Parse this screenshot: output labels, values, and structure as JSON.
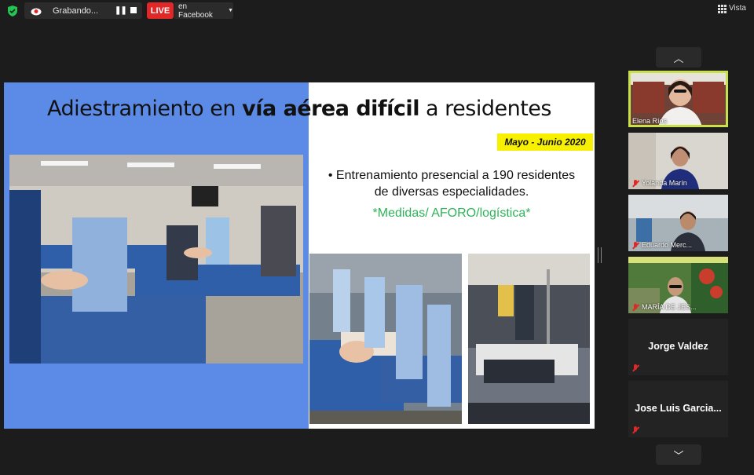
{
  "topbar": {
    "recording_label": "Grabando...",
    "live_label": "LIVE",
    "facebook_label": "en Facebook",
    "view_label": "Vista"
  },
  "slide": {
    "title_pre": "Adiestramiento en ",
    "title_bold": "vía aérea difícil",
    "title_post": " a residentes",
    "date_badge": "Mayo - Junio 2020",
    "bullet_line1": "Entrenamiento presencial a 190 residentes",
    "bullet_line2": "de diversas especialidades.",
    "green_text": "*Medidas/ AFORO/logística*"
  },
  "participants": [
    {
      "name": "Elena Ríos",
      "muted": false,
      "video": true
    },
    {
      "name": "Yolanda Marín",
      "muted": true,
      "video": true
    },
    {
      "name": "Eduardo Merc...",
      "muted": true,
      "video": true
    },
    {
      "name": "MARÍA DE JES...",
      "muted": true,
      "video": true
    },
    {
      "name": "Jorge Valdez",
      "muted": true,
      "video": false
    },
    {
      "name": "Jose Luis Garcia...",
      "muted": true,
      "video": false
    }
  ],
  "colors": {
    "background": "#1c1c1c",
    "slide_blue": "#5b8be6",
    "live_red": "#e02828",
    "badge_yellow": "#f7f000",
    "green_text": "#2fb35a",
    "active_speaker": "#c8e04a"
  }
}
